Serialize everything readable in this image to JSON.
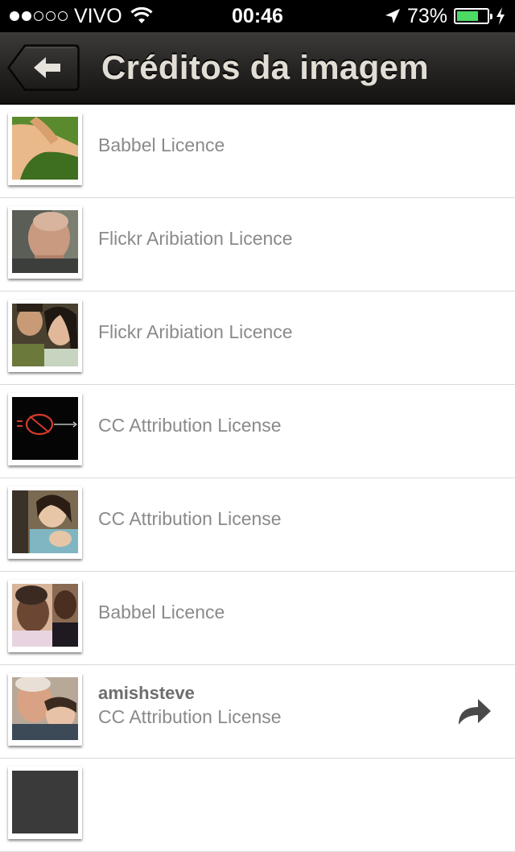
{
  "status_bar": {
    "carrier": "VIVO",
    "time": "00:46",
    "battery": "73%",
    "battery_level": 0.73,
    "signal_dots_filled": 2,
    "signal_dots_total": 5
  },
  "nav": {
    "title": "Créditos da imagem",
    "back_icon": "arrow-left-icon"
  },
  "credits": [
    {
      "author": "",
      "license": "Babbel Licence",
      "thumbnail": "legs-on-grass"
    },
    {
      "author": "",
      "license": "Flickr Aribiation Licence",
      "thumbnail": "bald-man-profile"
    },
    {
      "author": "",
      "license": "Flickr Aribiation Licence",
      "thumbnail": "couple-eating"
    },
    {
      "author": "",
      "license": "CC Attribution License",
      "thumbnail": "neon-ok-sign"
    },
    {
      "author": "",
      "license": "CC Attribution License",
      "thumbnail": "mother-and-child"
    },
    {
      "author": "",
      "license": "Babbel Licence",
      "thumbnail": "smiling-children"
    },
    {
      "author": "amishsteve",
      "license": "CC Attribution License",
      "thumbnail": "father-and-son",
      "share_icon": "share-arrow-icon"
    }
  ],
  "colors": {
    "nav_background": "#252321",
    "nav_title": "#e2ddd5",
    "license_text": "#8a8a8a",
    "battery_green": "#4cd964"
  }
}
